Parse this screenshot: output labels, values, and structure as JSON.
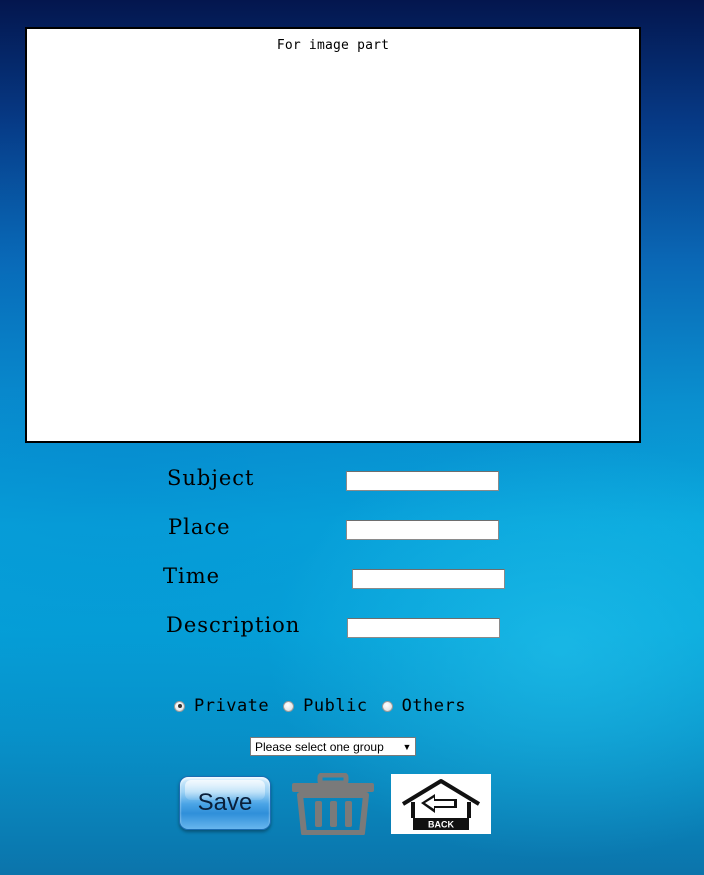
{
  "image_panel": {
    "caption": "For image part"
  },
  "form": {
    "subject": {
      "label": "Subject",
      "value": ""
    },
    "place": {
      "label": "Place",
      "value": ""
    },
    "time": {
      "label": "Time",
      "value": ""
    },
    "description": {
      "label": "Description",
      "value": ""
    }
  },
  "visibility": {
    "options": [
      {
        "label": "Private",
        "checked": true
      },
      {
        "label": "Public",
        "checked": false
      },
      {
        "label": "Others",
        "checked": false
      }
    ]
  },
  "group_select": {
    "selected": "Please select one group"
  },
  "actions": {
    "save_label": "Save",
    "delete_icon": "trash-icon",
    "back_label": "BACK",
    "back_icon": "home-back-arrow-icon"
  },
  "colors": {
    "background_top": "#04164e",
    "background_mid": "#08a9dd",
    "save_button": "#2f8fd9",
    "trash_icon": "#7a7a7a"
  }
}
